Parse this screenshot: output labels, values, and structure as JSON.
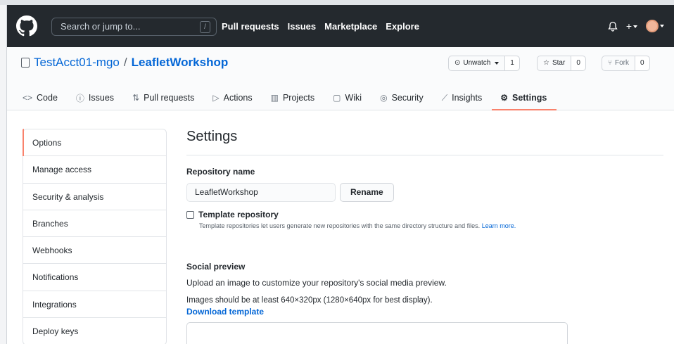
{
  "header": {
    "search_placeholder": "Search or jump to...",
    "search_key": "/",
    "nav": [
      "Pull requests",
      "Issues",
      "Marketplace",
      "Explore"
    ],
    "plus_label": "+"
  },
  "repo": {
    "owner": "TestAcct01-mgo",
    "separator": "/",
    "name": "LeafletWorkshop",
    "watch_label": "Unwatch",
    "watch_count": "1",
    "star_label": "Star",
    "star_count": "0",
    "fork_label": "Fork",
    "fork_count": "0"
  },
  "tabs": [
    {
      "icon": "<>",
      "label": "Code"
    },
    {
      "icon": "ⓘ",
      "label": "Issues"
    },
    {
      "icon": "⇅",
      "label": "Pull requests"
    },
    {
      "icon": "▷",
      "label": "Actions"
    },
    {
      "icon": "▥",
      "label": "Projects"
    },
    {
      "icon": "▢",
      "label": "Wiki"
    },
    {
      "icon": "◎",
      "label": "Security"
    },
    {
      "icon": "⟋",
      "label": "Insights"
    },
    {
      "icon": "⚙",
      "label": "Settings"
    }
  ],
  "sidebar": {
    "items": [
      "Options",
      "Manage access",
      "Security & analysis",
      "Branches",
      "Webhooks",
      "Notifications",
      "Integrations",
      "Deploy keys"
    ]
  },
  "main": {
    "title": "Settings",
    "repo_name_label": "Repository name",
    "repo_name_value": "LeafletWorkshop",
    "rename_button": "Rename",
    "template_label": "Template repository",
    "template_note": "Template repositories let users generate new repositories with the same directory structure and files.",
    "learn_more": "Learn more.",
    "social_title": "Social preview",
    "social_desc": "Upload an image to customize your repository's social media preview.",
    "social_hint": "Images should be at least 640×320px (1280×640px for best display).",
    "download_template": "Download template"
  },
  "colors": {
    "header_bg": "#24292e",
    "link": "#0366d6",
    "active_tab_underline": "#f9826c"
  }
}
